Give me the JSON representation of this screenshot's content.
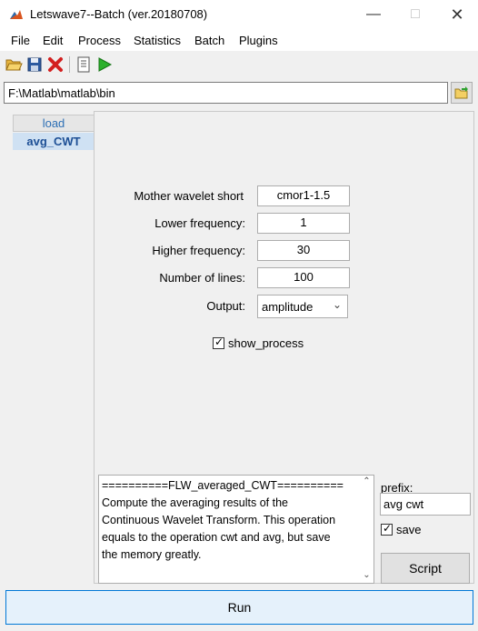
{
  "window": {
    "title": "Letswave7--Batch (ver.20180708)"
  },
  "menu": [
    "File",
    "Edit",
    "Process",
    "Statistics",
    "Batch",
    "Plugins"
  ],
  "toolbar": {
    "icons": [
      "open-folder-icon",
      "save-icon",
      "delete-icon",
      "script-icon",
      "run-icon"
    ]
  },
  "path": {
    "value": "F:\\Matlab\\matlab\\bin"
  },
  "steps": [
    {
      "label": "load",
      "selected": false
    },
    {
      "label": "avg_CWT",
      "selected": true
    }
  ],
  "form": {
    "mother_wavelet": {
      "label": "Mother wavelet short",
      "value": "cmor1-1.5"
    },
    "lower_freq": {
      "label": "Lower frequency:",
      "value": "1"
    },
    "higher_freq": {
      "label": "Higher frequency:",
      "value": "30"
    },
    "num_lines": {
      "label": "Number of lines:",
      "value": "100"
    },
    "output": {
      "label": "Output:",
      "value": "amplitude"
    },
    "show_process": {
      "label": "show_process",
      "checked": true
    }
  },
  "description": {
    "heading": "==========FLW_averaged_CWT==========",
    "line1": "Compute the averaging results of the",
    "line2": "Continuous Wavelet Transform. This operation",
    "line3": "equals to the operation cwt and avg, but save",
    "line4": "the memory greatly."
  },
  "prefix": {
    "label": "prefix:",
    "value": "avg cwt"
  },
  "save": {
    "label": "save",
    "checked": true
  },
  "buttons": {
    "script": "Script",
    "run": "Run"
  }
}
